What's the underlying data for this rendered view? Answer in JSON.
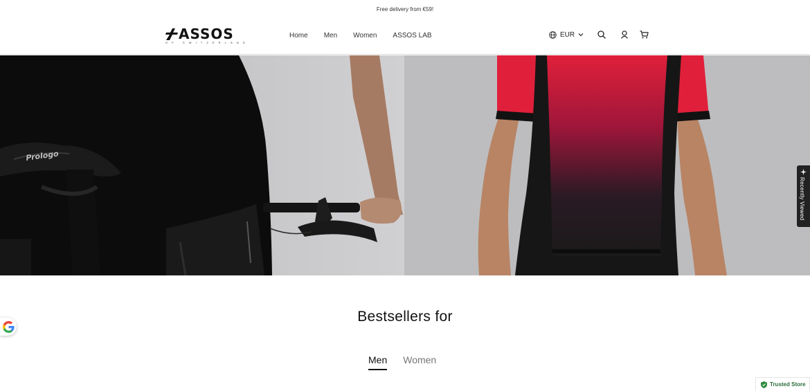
{
  "announcement": {
    "text": "Free delivery from €59!"
  },
  "header": {
    "logo": {
      "brand": "ASSOS",
      "tagline": "OF SWITZERLAND"
    },
    "nav": [
      {
        "label": "Home"
      },
      {
        "label": "Men"
      },
      {
        "label": "Women"
      },
      {
        "label": "ASSOS LAB"
      }
    ],
    "currency": {
      "label": "EUR",
      "icon": "globe-icon"
    },
    "icons": [
      "search-icon",
      "account-icon",
      "cart-icon"
    ]
  },
  "recently_viewed": {
    "label": "Recently Viewed",
    "icon": "sparkle-icon"
  },
  "bestsellers": {
    "title": "Bestsellers for",
    "tabs": [
      {
        "label": "Men",
        "active": true
      },
      {
        "label": "Women",
        "active": false
      }
    ]
  },
  "trusted_store": {
    "label": "Trusted Store",
    "icon": "shield-check-icon",
    "color": "#2b8a3e"
  },
  "colors": {
    "jersey_red": "#e0203a",
    "black": "#111111",
    "divider": "#d9d9d9"
  }
}
